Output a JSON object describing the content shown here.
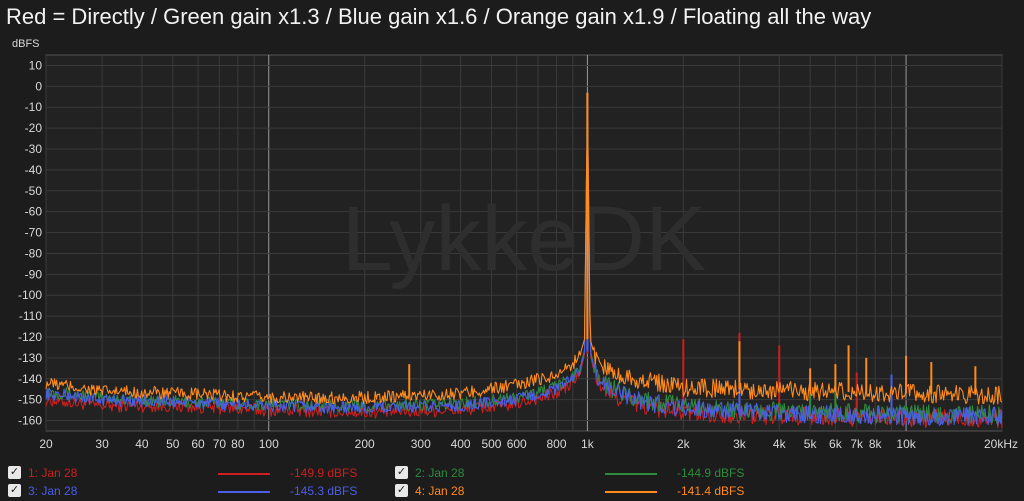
{
  "title": "Red = Directly / Green gain x1.3 / Blue gain x1.6 / Orange gain x1.9 / Floating all the way",
  "watermark": "LykkeDK",
  "chart_data": {
    "type": "line",
    "title": "Red = Directly / Green gain x1.3 / Blue gain x1.6 / Orange gain x1.9 / Floating all the way",
    "ylabel": "dBFS",
    "xlabel": "",
    "x_scale": "log",
    "xlim": [
      20,
      20000
    ],
    "ylim": [
      -165,
      15
    ],
    "x_ticks": [
      20,
      30,
      40,
      50,
      60,
      70,
      80,
      100,
      200,
      300,
      400,
      500,
      600,
      800,
      1000,
      2000,
      3000,
      4000,
      5000,
      6000,
      7000,
      8000,
      10000,
      20000
    ],
    "x_tick_labels": [
      "20",
      "30",
      "40",
      "50",
      "60",
      "70",
      "80",
      "100",
      "200",
      "300",
      "400",
      "500",
      "600",
      "800",
      "1k",
      "2k",
      "3k",
      "4k",
      "5k",
      "6k",
      "7k",
      "8k",
      "10k",
      "20kHz"
    ],
    "y_ticks": [
      10,
      0,
      -10,
      -20,
      -30,
      -40,
      -50,
      -60,
      -70,
      -80,
      -90,
      -100,
      -110,
      -120,
      -130,
      -140,
      -150,
      -160
    ],
    "y_tick_labels": [
      "10",
      "0",
      "-10",
      "-20",
      "-30",
      "-40",
      "-50",
      "-60",
      "-70",
      "-80",
      "-90",
      "-100",
      "-110",
      "-120",
      "-130",
      "-140",
      "-150",
      "-160"
    ],
    "grid": true,
    "legend_position": "bottom",
    "series": [
      {
        "name": "1: Jan 28",
        "color": "#cc1f1f",
        "value_label": "-149.9 dBFS",
        "x": [
          20,
          30,
          50,
          100,
          200,
          400,
          600,
          800,
          900,
          950,
          980,
          1000,
          1020,
          1050,
          1100,
          1200,
          1500,
          2000,
          3000,
          5000,
          10000,
          20000
        ],
        "y": [
          -150,
          -153,
          -153,
          -155,
          -156,
          -155,
          -152,
          -147,
          -142,
          -137,
          -128,
          -3,
          -128,
          -137,
          -143,
          -148,
          -153,
          -156,
          -157,
          -158,
          -159,
          -159
        ],
        "spurs": [
          [
            2000,
            -121
          ],
          [
            3000,
            -118
          ],
          [
            4000,
            -124
          ],
          [
            5000,
            -138
          ],
          [
            7000,
            -137
          ],
          [
            9000,
            -139
          ]
        ]
      },
      {
        "name": "2: Jan 28",
        "color": "#2e8b3d",
        "value_label": "-144.9 dBFS",
        "x": [
          20,
          30,
          50,
          100,
          200,
          400,
          600,
          800,
          900,
          950,
          980,
          1000,
          1020,
          1050,
          1100,
          1200,
          1500,
          2000,
          3000,
          5000,
          10000,
          20000
        ],
        "y": [
          -146,
          -149,
          -151,
          -152,
          -153,
          -152,
          -149,
          -144,
          -139,
          -134,
          -126,
          -3,
          -126,
          -134,
          -140,
          -145,
          -150,
          -153,
          -155,
          -156,
          -157,
          -157
        ],
        "spurs": [
          [
            3000,
            -127
          ],
          [
            5000,
            -139
          ],
          [
            6000,
            -141
          ]
        ]
      },
      {
        "name": "3: Jan 28",
        "color": "#4a5ee8",
        "value_label": "-145.3 dBFS",
        "x": [
          20,
          30,
          50,
          100,
          200,
          400,
          600,
          800,
          900,
          950,
          980,
          1000,
          1020,
          1050,
          1100,
          1200,
          1500,
          2000,
          3000,
          5000,
          10000,
          20000
        ],
        "y": [
          -147,
          -150,
          -151,
          -153,
          -154,
          -153,
          -150,
          -145,
          -140,
          -135,
          -127,
          -3,
          -127,
          -135,
          -141,
          -146,
          -151,
          -154,
          -156,
          -157,
          -158,
          -158
        ],
        "spurs": [
          [
            3000,
            -128
          ],
          [
            9000,
            -138
          ]
        ]
      },
      {
        "name": "4: Jan 28",
        "color": "#ff8a1e",
        "value_label": "-141.4 dBFS",
        "x": [
          20,
          30,
          50,
          100,
          200,
          400,
          600,
          800,
          900,
          950,
          980,
          1000,
          1020,
          1050,
          1100,
          1200,
          1500,
          2000,
          3000,
          5000,
          10000,
          20000
        ],
        "y": [
          -142,
          -146,
          -147,
          -149,
          -149,
          -147,
          -143,
          -138,
          -133,
          -128,
          -121,
          -3,
          -121,
          -128,
          -133,
          -137,
          -141,
          -144,
          -145,
          -146,
          -147,
          -148
        ],
        "spurs": [
          [
            276,
            -133
          ],
          [
            3000,
            -122
          ],
          [
            5000,
            -135
          ],
          [
            6000,
            -133
          ],
          [
            6600,
            -124
          ],
          [
            7500,
            -130
          ],
          [
            10000,
            -129
          ],
          [
            12000,
            -132
          ],
          [
            16500,
            -134
          ]
        ]
      }
    ]
  },
  "legend": [
    {
      "check": "✓",
      "name": "1: Jan 28",
      "value": "-149.9 dBFS",
      "color": "#cc1f1f"
    },
    {
      "check": "✓",
      "name": "2: Jan 28",
      "value": "-144.9 dBFS",
      "color": "#2e8b3d"
    },
    {
      "check": "✓",
      "name": "3: Jan 28",
      "value": "-145.3 dBFS",
      "color": "#4a5ee8"
    },
    {
      "check": "✓",
      "name": "4: Jan 28",
      "value": "-141.4 dBFS",
      "color": "#ff8a1e"
    }
  ]
}
